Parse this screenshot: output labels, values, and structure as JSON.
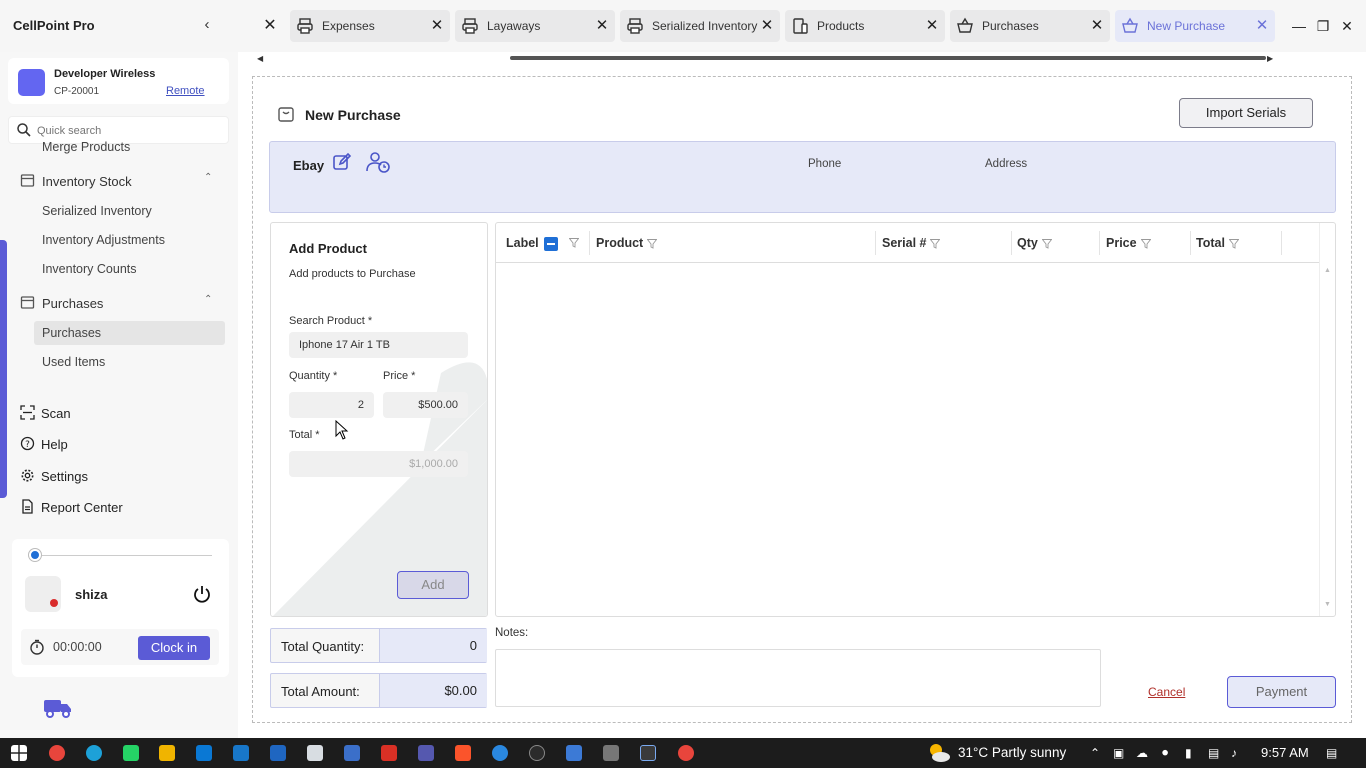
{
  "app": {
    "title": "CellPoint Pro",
    "accent_color": "#5b5bd6"
  },
  "tabs": [
    {
      "label": "Expenses",
      "icon": "printer-icon"
    },
    {
      "label": "Layaways",
      "icon": "printer-icon"
    },
    {
      "label": "Serialized Inventory",
      "icon": "printer-icon"
    },
    {
      "label": "Products",
      "icon": "devices-icon"
    },
    {
      "label": "Purchases",
      "icon": "basket-icon"
    },
    {
      "label": "New Purchase",
      "icon": "basket-icon",
      "active": true
    }
  ],
  "sidebar": {
    "company": {
      "name": "Developer Wireless",
      "id": "CP-20001",
      "link": "Remote"
    },
    "search": {
      "placeholder": "Quick search"
    },
    "partial_item": "Merge Products",
    "inventory_stock": {
      "label": "Inventory Stock",
      "items": [
        "Serialized Inventory",
        "Inventory Adjustments",
        "Inventory Counts"
      ]
    },
    "purchases": {
      "label": "Purchases",
      "items": [
        "Purchases",
        "Used Items"
      ],
      "selected": "Purchases"
    },
    "nav": [
      {
        "label": "Scan",
        "icon": "scan-icon"
      },
      {
        "label": "Help",
        "icon": "help-icon"
      },
      {
        "label": "Settings",
        "icon": "gear-icon"
      },
      {
        "label": "Report Center",
        "icon": "report-icon"
      }
    ],
    "user": {
      "name": "shiza",
      "timer": "00:00:00",
      "clock_in": "Clock in"
    }
  },
  "main": {
    "title": "New Purchase",
    "import_button": "Import Serials",
    "vendor": {
      "name": "Ebay",
      "phone_label": "Phone",
      "address_label": "Address"
    },
    "add_product": {
      "title": "Add Product",
      "subtitle": "Add products to Purchase",
      "search_label": "Search Product *",
      "search_value": "Iphone 17 Air 1 TB",
      "quantity_label": "Quantity *",
      "quantity_value": "2",
      "price_label": "Price *",
      "price_value": "$500.00",
      "total_label": "Total *",
      "total_value": "$1,000.00",
      "add_button": "Add"
    },
    "grid": {
      "columns": [
        "Label",
        "Product",
        "Serial #",
        "Qty",
        "Price",
        "Total"
      ],
      "rows": []
    },
    "totals": {
      "quantity_label": "Total Quantity:",
      "quantity_value": "0",
      "amount_label": "Total Amount:",
      "amount_value": "$0.00"
    },
    "notes_label": "Notes:",
    "cancel": "Cancel",
    "payment": "Payment"
  },
  "taskbar": {
    "weather": "31°C  Partly sunny",
    "time": "9:57 AM"
  }
}
